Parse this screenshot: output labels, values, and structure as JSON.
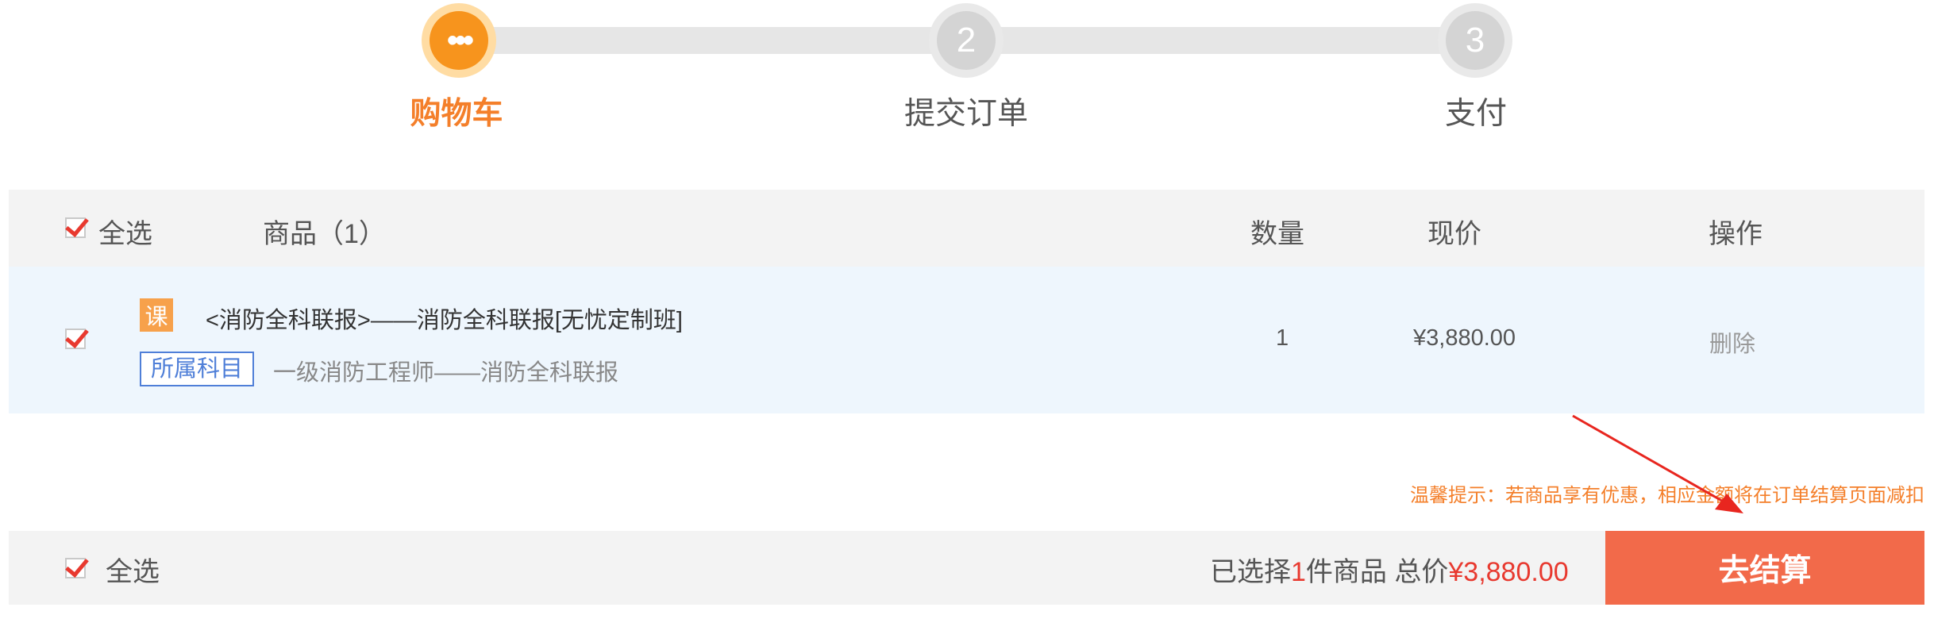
{
  "steps": [
    {
      "number": "•••",
      "label": "购物车",
      "state": "active"
    },
    {
      "number": "2",
      "label": "提交订单",
      "state": "pending"
    },
    {
      "number": "3",
      "label": "支付",
      "state": "pending"
    }
  ],
  "table": {
    "select_all_label": "全选",
    "columns": {
      "product": "商品（1）",
      "quantity": "数量",
      "price": "现价",
      "action": "操作"
    }
  },
  "product": {
    "tag": "课",
    "title": "<消防全科联报>——消防全科联报[无忧定制班]",
    "subject_tag": "所属科目",
    "subject": "一级消防工程师——消防全科联报",
    "quantity": "1",
    "price": "¥3,880.00",
    "delete_label": "删除"
  },
  "tip": "温馨提示：若商品享有优惠，相应金额将在订单结算页面减扣",
  "footer": {
    "select_all_label": "全选",
    "selected_prefix": "已选择",
    "selected_count": "1",
    "selected_suffix": "件商品 总价",
    "total": "¥3,880.00",
    "checkout_label": "去结算"
  },
  "colors": {
    "accent_orange": "#f47f2a",
    "checkout_red": "#f26a4a",
    "checkbox_red": "#e8392f",
    "subject_blue": "#4f7fd8",
    "annotation_arrow": "#e8261f"
  }
}
